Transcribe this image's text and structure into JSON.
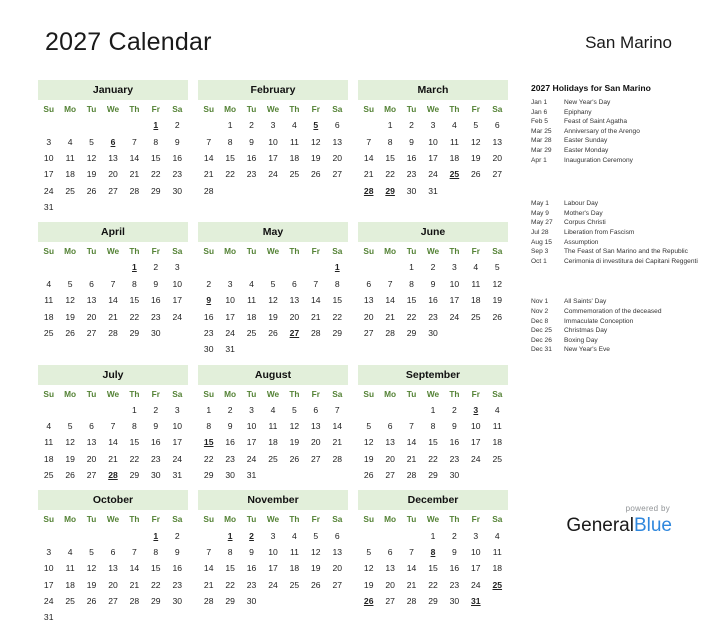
{
  "header": {
    "title": "2027 Calendar",
    "country": "San Marino"
  },
  "weekdays": [
    "Su",
    "Mo",
    "Tu",
    "We",
    "Th",
    "Fr",
    "Sa"
  ],
  "colors": {
    "month_header_bg": "#e2efda",
    "weekday_label": "#548235",
    "holiday_red": "#e8000d",
    "logo_blue": "#2f87dd"
  },
  "months": [
    {
      "name": "January",
      "lead_blank": 5,
      "days": 31,
      "holidays": [
        1,
        6
      ]
    },
    {
      "name": "February",
      "lead_blank": 1,
      "days": 28,
      "holidays": [
        5
      ]
    },
    {
      "name": "March",
      "lead_blank": 1,
      "days": 31,
      "holidays": [
        25,
        28,
        29
      ]
    },
    {
      "name": "April",
      "lead_blank": 4,
      "days": 30,
      "holidays": [
        1
      ]
    },
    {
      "name": "May",
      "lead_blank": 6,
      "days": 31,
      "holidays": [
        1,
        9,
        27
      ]
    },
    {
      "name": "June",
      "lead_blank": 2,
      "days": 30,
      "holidays": []
    },
    {
      "name": "July",
      "lead_blank": 4,
      "days": 31,
      "holidays": [
        28
      ]
    },
    {
      "name": "August",
      "lead_blank": 0,
      "days": 31,
      "holidays": [
        15
      ]
    },
    {
      "name": "September",
      "lead_blank": 3,
      "days": 30,
      "holidays": [
        3
      ]
    },
    {
      "name": "October",
      "lead_blank": 5,
      "days": 31,
      "holidays": [
        1
      ]
    },
    {
      "name": "November",
      "lead_blank": 1,
      "days": 30,
      "holidays": [
        1,
        2
      ]
    },
    {
      "name": "December",
      "lead_blank": 3,
      "days": 31,
      "holidays": [
        8,
        25,
        26,
        31
      ]
    }
  ],
  "holidays_panel": {
    "heading": "2027 Holidays for San Marino",
    "groups": [
      [
        {
          "date": "Jan 1",
          "name": "New Year's Day"
        },
        {
          "date": "Jan 6",
          "name": "Epiphany"
        },
        {
          "date": "Feb 5",
          "name": "Feast of Saint Agatha"
        },
        {
          "date": "Mar 25",
          "name": "Anniversary of the Arengo"
        },
        {
          "date": "Mar 28",
          "name": "Easter Sunday"
        },
        {
          "date": "Mar 29",
          "name": "Easter Monday"
        },
        {
          "date": "Apr 1",
          "name": "Inauguration Ceremony"
        }
      ],
      [
        {
          "date": "May 1",
          "name": "Labour Day"
        },
        {
          "date": "May 9",
          "name": "Mother's Day"
        },
        {
          "date": "May 27",
          "name": "Corpus Christi"
        },
        {
          "date": "Jul 28",
          "name": "Liberation from Fascism"
        },
        {
          "date": "Aug 15",
          "name": "Assumption"
        },
        {
          "date": "Sep 3",
          "name": "The Feast of San Marino and the Republic"
        },
        {
          "date": "Oct 1",
          "name": "Cerimonia di investitura dei Capitani Reggenti"
        }
      ],
      [
        {
          "date": "Nov 1",
          "name": "All Saints' Day"
        },
        {
          "date": "Nov 2",
          "name": "Commemoration of the deceased"
        },
        {
          "date": "Dec 8",
          "name": "Immaculate Conception"
        },
        {
          "date": "Dec 25",
          "name": "Christmas Day"
        },
        {
          "date": "Dec 26",
          "name": "Boxing Day"
        },
        {
          "date": "Dec 31",
          "name": "New Year's Eve"
        }
      ]
    ]
  },
  "footer": {
    "powered_by": "powered by",
    "logo_part1": "General",
    "logo_part2": "Blue"
  }
}
